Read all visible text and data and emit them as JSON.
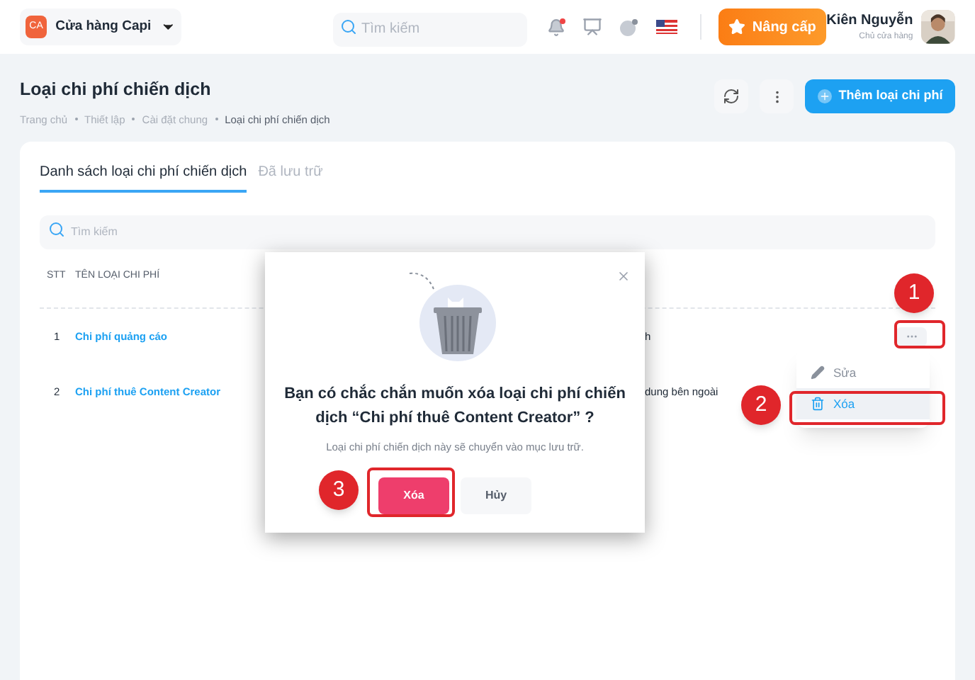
{
  "header": {
    "store_initials": "CA",
    "store_name": "Cửa hàng Capi",
    "search": {
      "placeholder": "Tìm kiếm"
    },
    "upgrade_button": "Nâng cấp",
    "user_name": "Kiên Nguyễn",
    "user_role": "Chủ cửa hàng"
  },
  "page": {
    "title": "Loại chi phí chiến dịch",
    "breadcrumb": [
      "Trang chủ",
      "Thiết lập",
      "Cài đặt chung",
      "Loại chi phí chiến dịch"
    ],
    "add_button": "Thêm loại chi phí"
  },
  "tabs": [
    {
      "label": "Danh sách loại chi phí chiến dịch",
      "selected": true
    },
    {
      "label": "Đã lưu trữ",
      "selected": false
    }
  ],
  "table_search": {
    "placeholder": "Tìm kiếm"
  },
  "table": {
    "columns": [
      "STT",
      "TÊN LOẠI CHI PHÍ"
    ],
    "rows": [
      {
        "index": "1",
        "name": "Chi phí quảng cáo",
        "column_3": "h"
      },
      {
        "index": "2",
        "name": "Chi phí thuê Content Creator",
        "column_3": "dung bên ngoài"
      }
    ]
  },
  "row_menu": [
    {
      "kind": "edit",
      "label": "Sửa",
      "selected": false
    },
    {
      "kind": "delete",
      "label": "Xóa",
      "selected": true
    }
  ],
  "dialog": {
    "title": "Bạn có chắc chắn muốn xóa loại chi phí chiến dịch “Chi phí thuê Content Creator” ?",
    "message": "Loại chi phí chiến dịch này sẽ chuyển vào mục lưu trữ.",
    "confirm_button": "Xóa",
    "cancel_button": "Hủy"
  },
  "callouts": [
    "1",
    "2",
    "3"
  ]
}
